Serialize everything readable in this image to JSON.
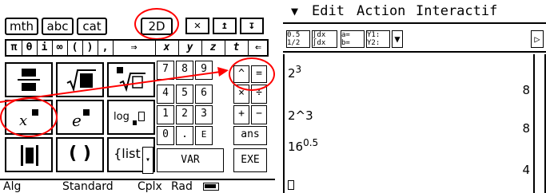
{
  "keyboard": {
    "tabs": [
      "mth",
      "abc",
      "cat",
      "2D"
    ],
    "top_buttons": [
      "✕",
      "↥",
      "↧"
    ],
    "symbols": [
      "π",
      "θ",
      "i",
      "∞",
      "(",
      ")",
      ",",
      "⇒",
      "x",
      "y",
      "z",
      "t",
      "⇐"
    ],
    "templates": {
      "fraction": "",
      "sqrt": "√",
      "nthroot": "√□",
      "power": "x",
      "exp": "e",
      "log": "log",
      "abs": "",
      "parens": "( )",
      "list": "{list}"
    },
    "numpad": [
      [
        "7",
        "8",
        "9",
        "^",
        "="
      ],
      [
        "4",
        "5",
        "6",
        "×",
        "÷"
      ],
      [
        "1",
        "2",
        "3",
        "+",
        "−"
      ],
      [
        "0",
        ".",
        "E",
        "ans"
      ]
    ],
    "var_label": "VAR",
    "exe_label": "EXE"
  },
  "status": {
    "mode": "Alg",
    "format": "Standard",
    "complex": "Cplx",
    "angle": "Rad"
  },
  "menu": {
    "arrow": "▼",
    "items": [
      "Edit",
      "Action",
      "Interactif"
    ]
  },
  "toolbar": {
    "b1a": "0.5",
    "b1b": "1/2",
    "b2a": "∫dx",
    "b2b": "∫dx",
    "b3a": "a=",
    "b3b": "b=",
    "b4a": "Y1:",
    "b4b": "Y2:",
    "dropdown": "▼",
    "scroll_right": "▷"
  },
  "main": {
    "lines": [
      {
        "base": "2",
        "exp": "3",
        "result": "8"
      },
      {
        "expr": "2^3",
        "result": "8"
      },
      {
        "base": "16",
        "exp": "0.5",
        "result": "4"
      }
    ]
  },
  "annotation_color": "#ff0000"
}
